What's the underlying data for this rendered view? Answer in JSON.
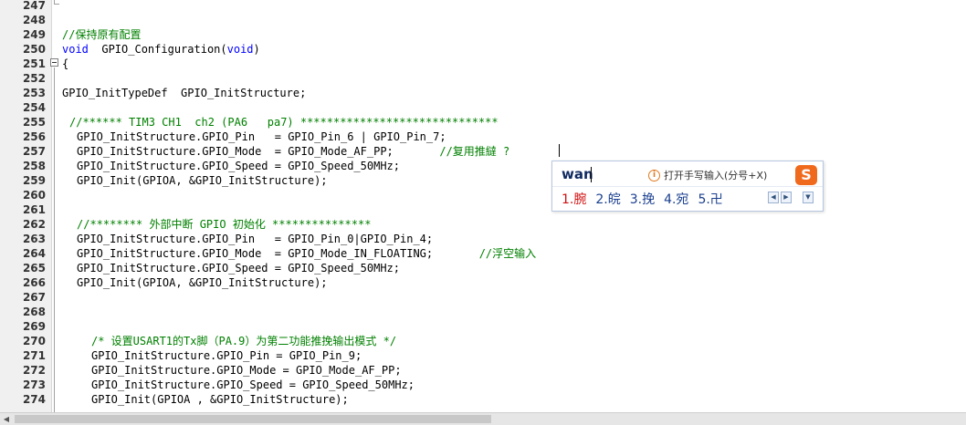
{
  "lines": [
    {
      "n": "247",
      "indent": 0,
      "text": ""
    },
    {
      "n": "248",
      "indent": 0,
      "text": ""
    },
    {
      "n": "249",
      "indent": 0,
      "cls": "cm",
      "text": "//保持原有配置"
    },
    {
      "n": "250",
      "indent": 0,
      "parts": [
        [
          "kw",
          "void"
        ],
        [
          "",
          "  GPIO_Configuration("
        ],
        [
          "kw",
          "void"
        ],
        [
          "",
          ")"
        ]
      ]
    },
    {
      "n": "251",
      "indent": 0,
      "text": "{"
    },
    {
      "n": "252",
      "indent": 0,
      "text": ""
    },
    {
      "n": "253",
      "indent": 0,
      "text": "GPIO_InitTypeDef  GPIO_InitStructure;"
    },
    {
      "n": "254",
      "indent": 0,
      "text": ""
    },
    {
      "n": "255",
      "indent": 1,
      "cls": "cm",
      "text": "//****** TIM3 CH1  ch2 (PA6   pa7) ******************************"
    },
    {
      "n": "256",
      "indent": 2,
      "text": "GPIO_InitStructure.GPIO_Pin   = GPIO_Pin_6 | GPIO_Pin_7;"
    },
    {
      "n": "257",
      "indent": 2,
      "parts": [
        [
          "",
          "GPIO_InitStructure.GPIO_Mode  = GPIO_Mode_AF_PP;       "
        ],
        [
          "cm",
          "//复用推繨 ?"
        ]
      ]
    },
    {
      "n": "258",
      "indent": 2,
      "text": "GPIO_InitStructure.GPIO_Speed = GPIO_Speed_50MHz;"
    },
    {
      "n": "259",
      "indent": 2,
      "text": "GPIO_Init(GPIOA, &GPIO_InitStructure);"
    },
    {
      "n": "260",
      "indent": 0,
      "text": ""
    },
    {
      "n": "261",
      "indent": 0,
      "text": ""
    },
    {
      "n": "262",
      "indent": 2,
      "cls": "cm",
      "text": "//******** 外部中断 GPIO 初始化 ***************"
    },
    {
      "n": "263",
      "indent": 2,
      "text": "GPIO_InitStructure.GPIO_Pin   = GPIO_Pin_0|GPIO_Pin_4;"
    },
    {
      "n": "264",
      "indent": 2,
      "parts": [
        [
          "",
          "GPIO_InitStructure.GPIO_Mode  = GPIO_Mode_IN_FLOATING;       "
        ],
        [
          "cm",
          "//浮空输入"
        ]
      ]
    },
    {
      "n": "265",
      "indent": 2,
      "text": "GPIO_InitStructure.GPIO_Speed = GPIO_Speed_50MHz;"
    },
    {
      "n": "266",
      "indent": 2,
      "text": "GPIO_Init(GPIOA, &GPIO_InitStructure);"
    },
    {
      "n": "267",
      "indent": 0,
      "text": ""
    },
    {
      "n": "268",
      "indent": 0,
      "text": ""
    },
    {
      "n": "269",
      "indent": 0,
      "text": ""
    },
    {
      "n": "270",
      "indent": 3,
      "cls": "cm",
      "text": "/* 设置USART1的Tx脚（PA.9）为第二功能推挽输出模式 */"
    },
    {
      "n": "271",
      "indent": 3,
      "text": "GPIO_InitStructure.GPIO_Pin = GPIO_Pin_9;"
    },
    {
      "n": "272",
      "indent": 3,
      "text": "GPIO_InitStructure.GPIO_Mode = GPIO_Mode_AF_PP;"
    },
    {
      "n": "273",
      "indent": 3,
      "text": "GPIO_InitStructure.GPIO_Speed = GPIO_Speed_50MHz;"
    },
    {
      "n": "274",
      "indent": 3,
      "text": "GPIO_Init(GPIOA , &GPIO_InitStructure);"
    }
  ],
  "ime": {
    "pinyin": "wan",
    "hint": "打开手写输入(分号+X)",
    "logo": "S",
    "candidates": [
      "1.腕",
      "2.皖",
      "3.挽",
      "4.宛",
      "5.卍"
    ],
    "prev_glyph": "◀",
    "next_glyph": "▶",
    "menu_glyph": "▼",
    "colors": {
      "accent": "#f06a1e",
      "border": "#b8c8e0",
      "first_candidate": "#d01010"
    }
  },
  "scrollbar": {
    "left_arrow": "◀"
  }
}
